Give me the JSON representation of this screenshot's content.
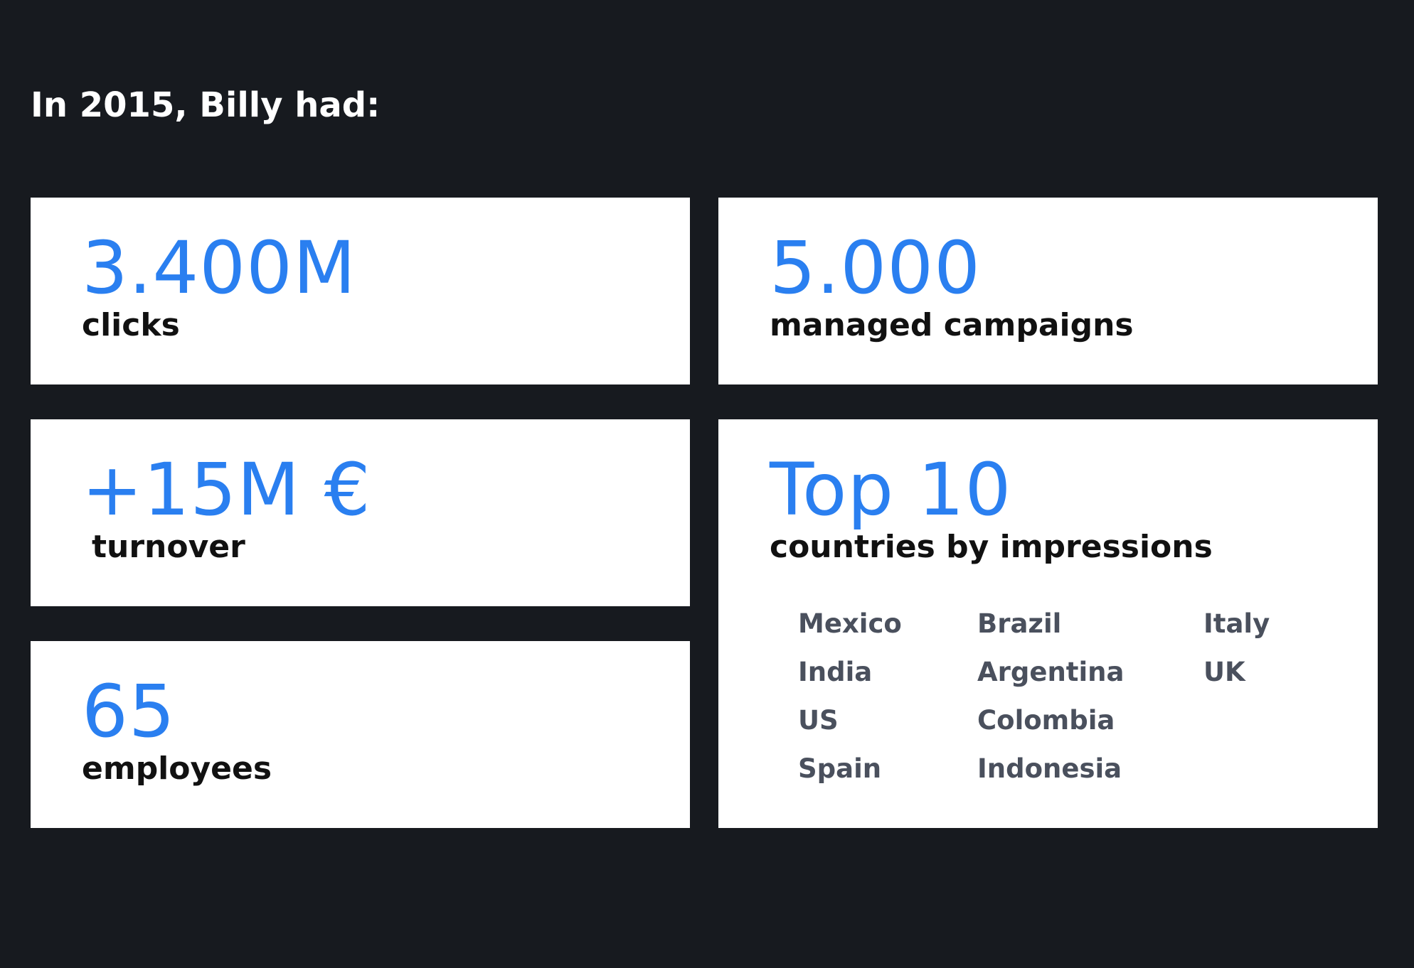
{
  "headline": "In 2015, Billy had:",
  "accent_color": "#2a7ff0",
  "background_color": "#171a1f",
  "stats": {
    "clicks": {
      "value": "3.400M",
      "label": "clicks"
    },
    "campaigns": {
      "value": "5.000",
      "label": "managed campaigns"
    },
    "turnover": {
      "value": "+15M €",
      "label": "turnover"
    },
    "employees": {
      "value": "65",
      "label": "employees"
    },
    "countries": {
      "value": "Top 10",
      "label": "countries by impressions",
      "list": [
        "Mexico",
        "India",
        "US",
        "Spain",
        "Brazil",
        "Argentina",
        "Colombia",
        "Indonesia",
        "Italy",
        "UK"
      ]
    }
  }
}
